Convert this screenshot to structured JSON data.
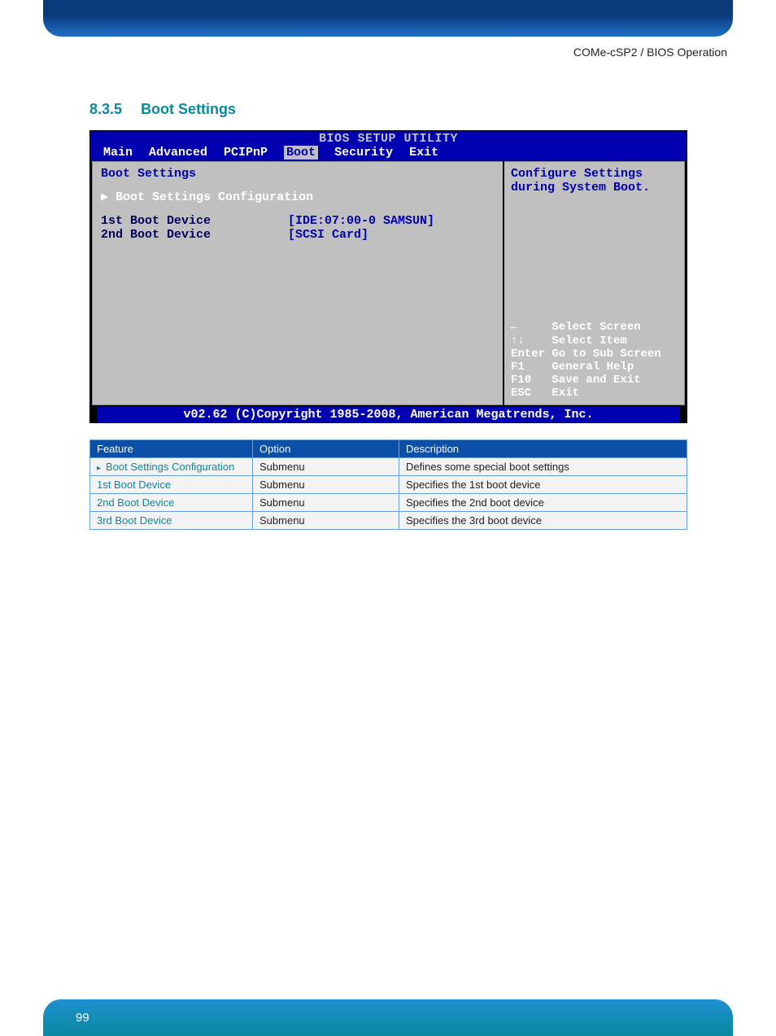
{
  "header": {
    "breadcrumb": "COMe-cSP2 / BIOS Operation"
  },
  "section": {
    "number": "8.3.5",
    "title": "Boot Settings"
  },
  "bios": {
    "title": "BIOS SETUP UTILITY",
    "tabs": [
      "Main",
      "Advanced",
      "PCIPnP",
      "Boot",
      "Security",
      "Exit"
    ],
    "active_tab_index": 3,
    "left": {
      "heading": "Boot Settings",
      "selected_item": "▶ Boot Settings Configuration",
      "rows": [
        {
          "label": "1st Boot Device",
          "value": "[IDE:07:00-0 SAMSUN]"
        },
        {
          "label": "2nd Boot Device",
          "value": "[SCSI Card]"
        }
      ]
    },
    "right": {
      "tip_line1": "Configure Settings",
      "tip_line2": "during System Boot.",
      "help": [
        {
          "key": "←",
          "action": "Select Screen"
        },
        {
          "key": "↑↓",
          "action": "Select Item"
        },
        {
          "key": "Enter",
          "action": "Go to Sub Screen"
        },
        {
          "key": "F1",
          "action": "General Help"
        },
        {
          "key": "F10",
          "action": "Save and Exit"
        },
        {
          "key": "ESC",
          "action": "Exit"
        }
      ]
    },
    "copyright": "v02.62 (C)Copyright 1985-2008, American Megatrends, Inc."
  },
  "table": {
    "headers": [
      "Feature",
      "Option",
      "Description"
    ],
    "rows": [
      {
        "feature": "Boot Settings Configuration",
        "caret": true,
        "option": "Submenu",
        "description": "Defines some special boot settings"
      },
      {
        "feature": "1st Boot Device",
        "caret": false,
        "option": "Submenu",
        "description": "Specifies the 1st boot device"
      },
      {
        "feature": "2nd Boot Device",
        "caret": false,
        "option": "Submenu",
        "description": "Specifies the 2nd boot device"
      },
      {
        "feature": "3rd Boot Device",
        "caret": false,
        "option": "Submenu",
        "description": "Specifies the 3rd boot device"
      }
    ]
  },
  "footer": {
    "page_number": "99"
  }
}
